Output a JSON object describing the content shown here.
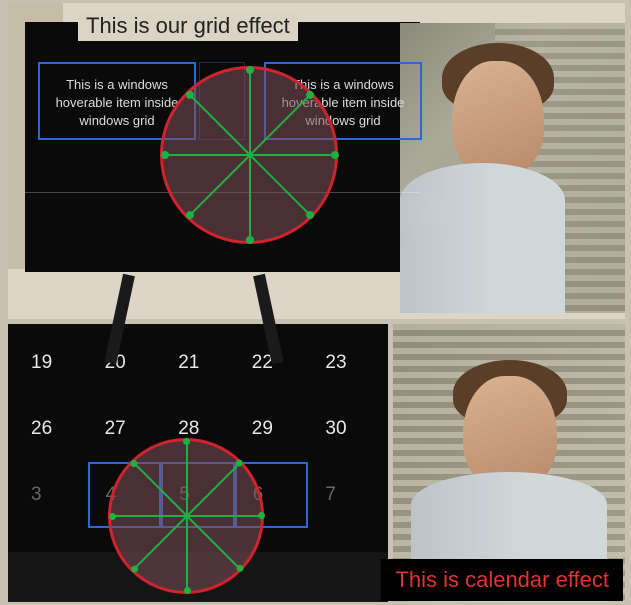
{
  "top": {
    "title": "This is our grid effect",
    "item1": "This is a windows hoverable item inside windows grid",
    "item2": "This is a windows hoverable item inside windows grid"
  },
  "calendar": {
    "row1": [
      "19",
      "20",
      "21",
      "22",
      "23"
    ],
    "row2": [
      "26",
      "27",
      "28",
      "29",
      "30"
    ],
    "row3": [
      "3",
      "4",
      "5",
      "6",
      "7"
    ]
  },
  "bottom": {
    "label": "This is calendar effect"
  }
}
